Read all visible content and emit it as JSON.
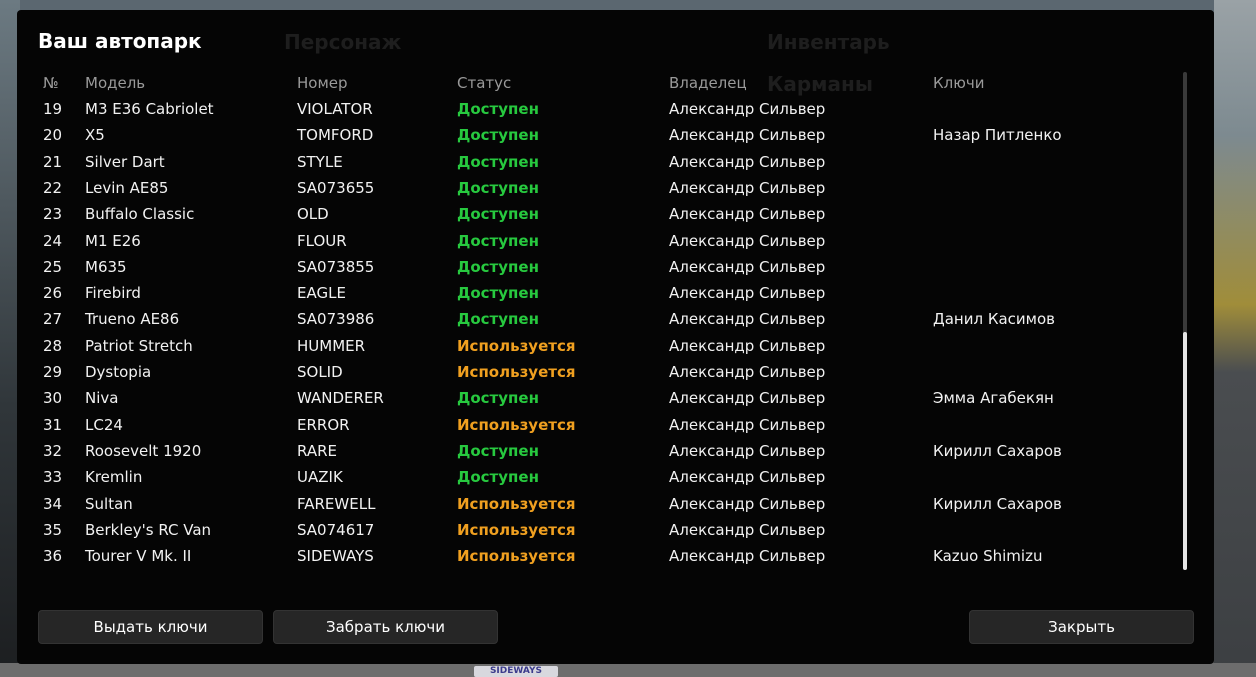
{
  "window": {
    "title": "Ваш автопарк"
  },
  "background_tabs": [
    "Персонаж",
    "Инвентарь",
    "Карманы"
  ],
  "columns": [
    "№",
    "Модель",
    "Номер",
    "Статус",
    "Владелец",
    "Ключи"
  ],
  "rows": [
    {
      "n": "19",
      "model": "M3 E36 Cabriolet",
      "plate": "VIOLATOR",
      "status": "Доступен",
      "owner": "Александр Сильвер",
      "keys": ""
    },
    {
      "n": "20",
      "model": "X5",
      "plate": "TOMFORD",
      "status": "Доступен",
      "owner": "Александр Сильвер",
      "keys": "Назар Питленко"
    },
    {
      "n": "21",
      "model": "Silver Dart",
      "plate": "STYLE",
      "status": "Доступен",
      "owner": "Александр Сильвер",
      "keys": ""
    },
    {
      "n": "22",
      "model": "Levin AE85",
      "plate": "SA073655",
      "status": "Доступен",
      "owner": "Александр Сильвер",
      "keys": ""
    },
    {
      "n": "23",
      "model": "Buffalo Classic",
      "plate": "OLD",
      "status": "Доступен",
      "owner": "Александр Сильвер",
      "keys": ""
    },
    {
      "n": "24",
      "model": "M1 E26",
      "plate": "FLOUR",
      "status": "Доступен",
      "owner": "Александр Сильвер",
      "keys": ""
    },
    {
      "n": "25",
      "model": "M635",
      "plate": "SA073855",
      "status": "Доступен",
      "owner": "Александр Сильвер",
      "keys": ""
    },
    {
      "n": "26",
      "model": "Firebird",
      "plate": "EAGLE",
      "status": "Доступен",
      "owner": "Александр Сильвер",
      "keys": ""
    },
    {
      "n": "27",
      "model": "Trueno AE86",
      "plate": "SA073986",
      "status": "Доступен",
      "owner": "Александр Сильвер",
      "keys": "Данил Касимов"
    },
    {
      "n": "28",
      "model": "Patriot Stretch",
      "plate": "HUMMER",
      "status": "Используется",
      "owner": "Александр Сильвер",
      "keys": ""
    },
    {
      "n": "29",
      "model": "Dystopia",
      "plate": "SOLID",
      "status": "Используется",
      "owner": "Александр Сильвер",
      "keys": ""
    },
    {
      "n": "30",
      "model": "Niva",
      "plate": "WANDERER",
      "status": "Доступен",
      "owner": "Александр Сильвер",
      "keys": "Эмма Агабекян"
    },
    {
      "n": "31",
      "model": "LC24",
      "plate": "ERROR",
      "status": "Используется",
      "owner": "Александр Сильвер",
      "keys": ""
    },
    {
      "n": "32",
      "model": "Roosevelt 1920",
      "plate": "RARE",
      "status": "Доступен",
      "owner": "Александр Сильвер",
      "keys": "Кирилл Сахаров"
    },
    {
      "n": "33",
      "model": "Kremlin",
      "plate": "UAZIK",
      "status": "Доступен",
      "owner": "Александр Сильвер",
      "keys": ""
    },
    {
      "n": "34",
      "model": "Sultan",
      "plate": "FAREWELL",
      "status": "Используется",
      "owner": "Александр Сильвер",
      "keys": "Кирилл Сахаров"
    },
    {
      "n": "35",
      "model": "Berkley's RC Van",
      "plate": "SA074617",
      "status": "Используется",
      "owner": "Александр Сильвер",
      "keys": ""
    },
    {
      "n": "36",
      "model": "Tourer V Mk. II",
      "plate": "SIDEWAYS",
      "status": "Используется",
      "owner": "Александр Сильвер",
      "keys": "Kazuo Shimizu"
    }
  ],
  "buttons": {
    "give_keys": "Выдать ключи",
    "take_keys": "Забрать ключи",
    "close": "Закрыть"
  },
  "background_plate": "SIDEWAYS",
  "colors": {
    "available": "#27c93f",
    "in_use": "#f0a020",
    "panel_bg": "#050505",
    "button_bg": "#262626"
  }
}
